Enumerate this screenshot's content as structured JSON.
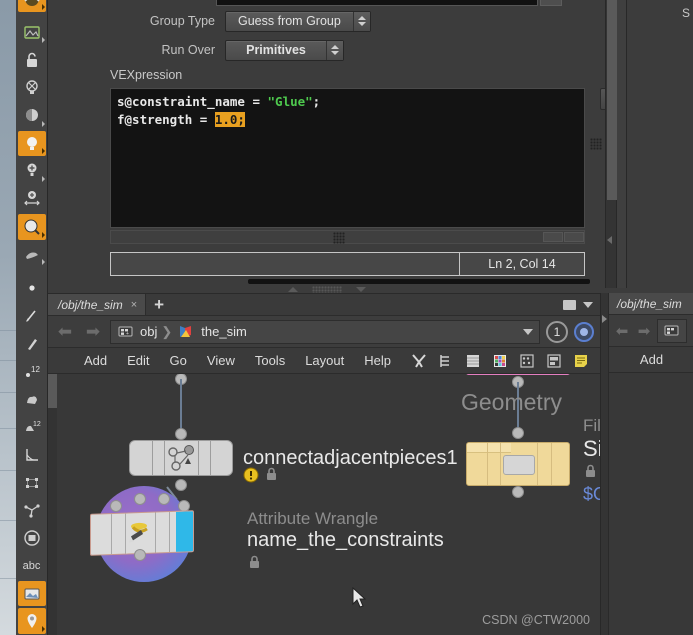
{
  "parameters": {
    "rows": [
      {
        "label": "Group Type",
        "value": "Guess from Group",
        "name": "group-type"
      },
      {
        "label": "Run Over",
        "value": "Primitives",
        "name": "run-over"
      }
    ],
    "vexpression_label": "VEXpression",
    "code": {
      "line1_a": "s@constraint_name = ",
      "line1_str": "\"Glue\"",
      "line1_b": ";",
      "line2_a": "f@strength = ",
      "line2_sel": "1.0;"
    },
    "status": {
      "left_value": "",
      "cursor_position": "Ln 2, Col 14"
    }
  },
  "network_editor": {
    "tab_label": "/obj/the_sim",
    "tab_close": "×",
    "new_tab": "+",
    "path": {
      "crumb1": "obj",
      "crumb_sep": "❯",
      "crumb2": "the_sim",
      "pin_count": "1"
    },
    "menu": [
      "Add",
      "Edit",
      "Go",
      "View",
      "Tools",
      "Layout",
      "Help"
    ],
    "nodes": [
      {
        "name": "connectadjacentpieces1",
        "type": "",
        "flags": "warning, locked"
      },
      {
        "type": "Attribute Wrangle",
        "name": "name_the_constraints",
        "flags": "locked"
      },
      {
        "type": "Geometry",
        "name_clipped_1": "Fil",
        "name_clipped_2": "Sin",
        "name_clipped_3": "$O"
      }
    ]
  },
  "network_editor_right": {
    "tab_label": "/obj/the_sim",
    "menu_first": "Add"
  },
  "top_right_pane": {
    "clipped_letter": "S"
  },
  "watermark": "CSDN @CTW2000",
  "colors": {
    "accent_orange": "#e8951f",
    "code_bg": "#131313",
    "string_green": "#4ec94e",
    "selection_orange": "#e8a020",
    "node_light": "#d4d4d4",
    "node_geo": "#f0d99a",
    "pink_bar": "#e47ec0",
    "panel_bg": "#3c3c3c"
  }
}
